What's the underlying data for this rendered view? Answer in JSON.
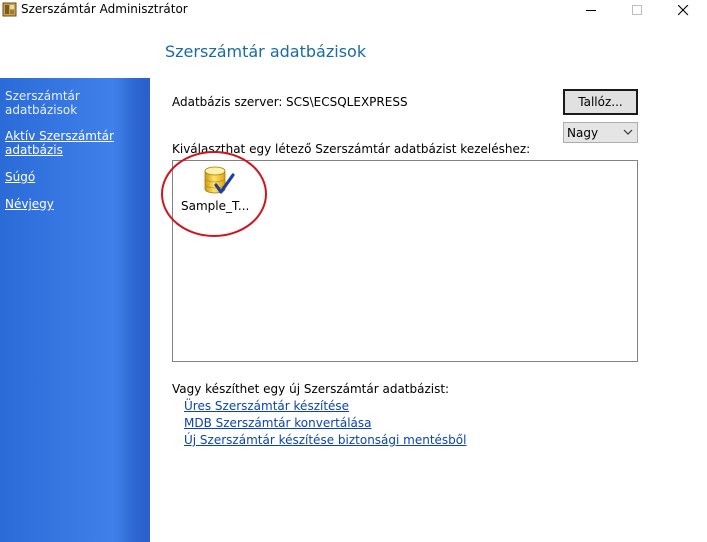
{
  "window": {
    "title": "Szerszámtár Adminisztrátor"
  },
  "page": {
    "title": "Szerszámtár adatbázisok"
  },
  "sidebar": {
    "items": [
      {
        "label_line1": "Szerszámtár",
        "label_line2": "adatbázisok",
        "active": true
      },
      {
        "label_line1": "Aktív Szerszámtár",
        "label_line2": "adatbázis",
        "active": false
      },
      {
        "label_line1": "Súgó",
        "active": false
      },
      {
        "label_line1": "Névjegy",
        "active": false
      }
    ]
  },
  "server": {
    "label": "Adatbázis szerver:",
    "value": "SCS\\ECSQLEXPRESS"
  },
  "browse_button": {
    "label": "Tallóz..."
  },
  "view_size": {
    "selected": "Nagy"
  },
  "database_list": {
    "prompt": "Kiválaszthat egy létező Szerszámtár adatbázist kezeléshez:",
    "items": [
      {
        "name": "Sample_T..."
      }
    ]
  },
  "create": {
    "prompt": "Vagy készíthet egy új Szerszámtár adatbázist:",
    "links": [
      "Üres Szerszámtár készítése",
      "MDB Szerszámtár konvertálása",
      "Új Szerszámtár készítése biztonsági mentésből"
    ]
  },
  "colors": {
    "accent_title": "#1a6aa6",
    "sidebar_blue": "#3f80ea",
    "link_blue": "#0b44b0",
    "annotation_red": "#d0141e"
  }
}
